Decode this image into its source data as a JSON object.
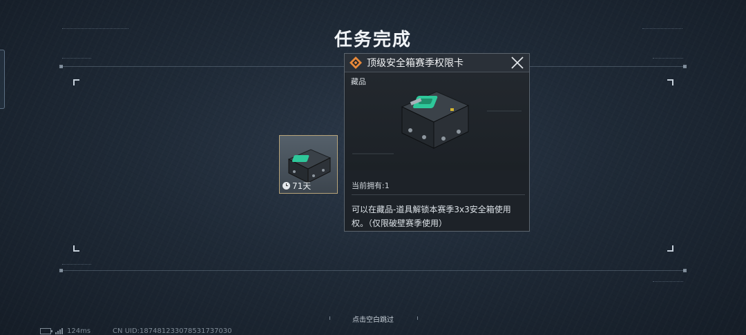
{
  "screen": {
    "title": "任务完成"
  },
  "reward_item": {
    "expire_label": "71天",
    "icon": "crate-icon"
  },
  "popup": {
    "title": "顶级安全箱赛季权限卡",
    "category": "藏品",
    "owned": "当前拥有:1",
    "description": "可以在藏品-道具解锁本赛季3x3安全箱使用权。（仅限破壁赛季使用）",
    "rarity_color": "#e8893a",
    "accent_color": "#2ec79a"
  },
  "footer": {
    "skip_hint": "点击空白跳过",
    "ping": "124ms",
    "uid": "CN UID:1874812330785317370​30"
  }
}
